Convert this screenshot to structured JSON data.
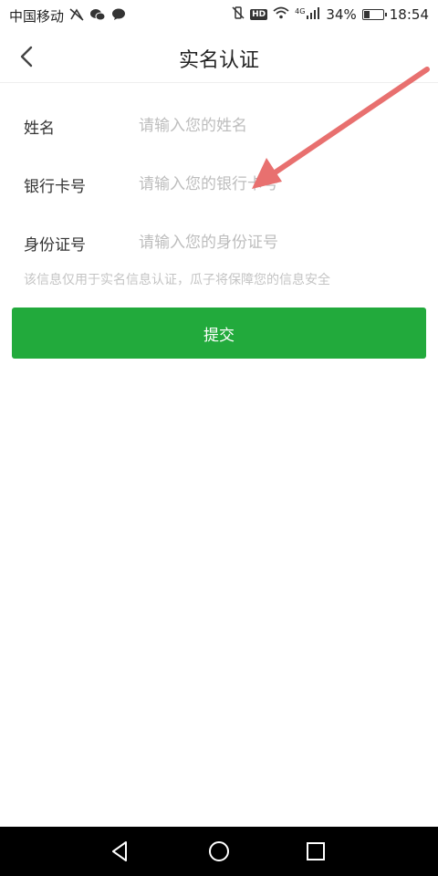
{
  "status_bar": {
    "carrier": "中国移动",
    "hd": "HD",
    "network": "4G",
    "battery_percent_text": "34%",
    "battery_level": 0.34,
    "time": "18:54"
  },
  "header": {
    "title": "实名认证"
  },
  "form": {
    "fields": [
      {
        "label": "姓名",
        "placeholder": "请输入您的姓名",
        "value": ""
      },
      {
        "label": "银行卡号",
        "placeholder": "请输入您的银行卡号",
        "value": ""
      },
      {
        "label": "身份证号",
        "placeholder": "请输入您的身份证号",
        "value": ""
      }
    ],
    "hint": "该信息仅用于实名信息认证，瓜子将保障您的信息安全"
  },
  "submit_label": "提交",
  "colors": {
    "accent": "#22aa3c",
    "annotation_arrow": "#e8706f"
  },
  "icons": [
    "mute-icon",
    "wechat-icon",
    "chat-bubble-icon",
    "vibrate-off-icon",
    "wifi-icon",
    "signal-icon",
    "battery-icon",
    "back-chevron-icon",
    "back-triangle-icon",
    "home-circle-icon",
    "recents-square-icon"
  ]
}
